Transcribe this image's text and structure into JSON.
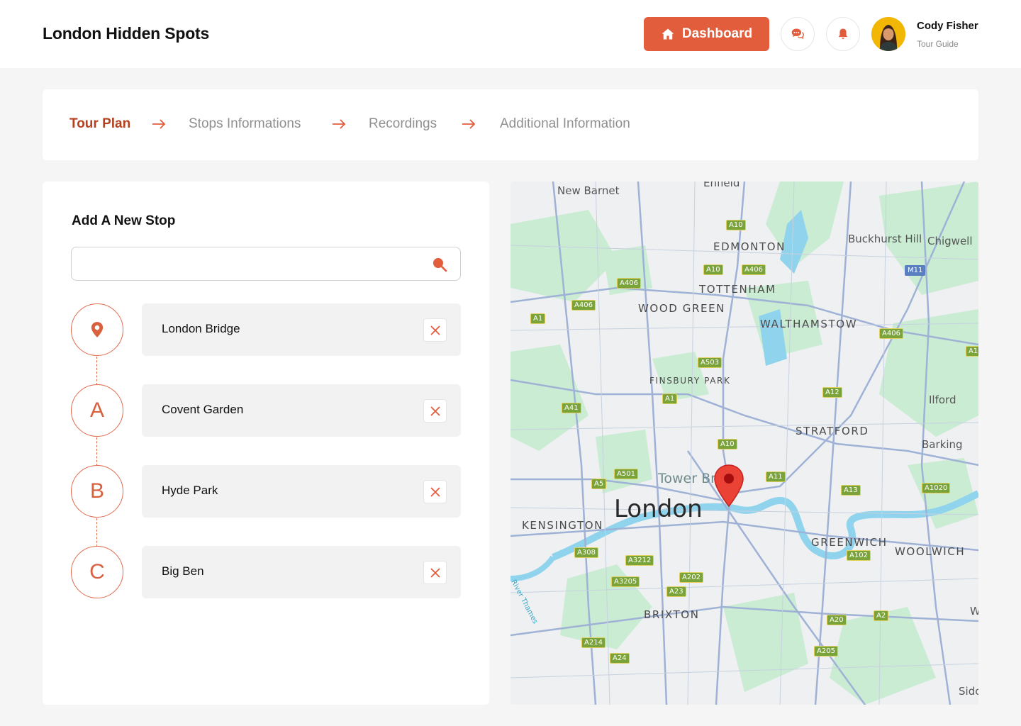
{
  "header": {
    "app_title": "London Hidden Spots",
    "dashboard_label": "Dashboard",
    "user": {
      "name": "Cody Fisher",
      "role": "Tour Guide"
    }
  },
  "stepper": {
    "steps": [
      {
        "label": "Tour Plan",
        "active": true
      },
      {
        "label": "Stops Informations",
        "active": false
      },
      {
        "label": "Recordings",
        "active": false
      },
      {
        "label": "Additional Information",
        "active": false
      }
    ]
  },
  "stop_panel": {
    "title": "Add A New Stop",
    "search_value": "",
    "stops": [
      {
        "marker": "",
        "marker_icon": "location-pin-icon",
        "label": "London Bridge"
      },
      {
        "marker": "A",
        "label": "Covent Garden"
      },
      {
        "marker": "B",
        "label": "Hyde Park"
      },
      {
        "marker": "C",
        "label": "Big Ben"
      }
    ]
  },
  "map": {
    "city_label": "London",
    "areas": [
      "EDMONTON",
      "TOTTENHAM",
      "WOOD GREEN",
      "WALTHAMSTOW",
      "FINSBURY PARK",
      "STRATFORD",
      "KENSINGTON",
      "GREENWICH",
      "WOOLWICH",
      "BRIXTON"
    ],
    "towns": [
      "New Barnet",
      "Enfield",
      "Buckhurst Hill",
      "Chigwell",
      "Ilford",
      "Barking",
      "Tower Br",
      "Sidc",
      "W"
    ],
    "roads": [
      "A10",
      "A10",
      "A406",
      "A406",
      "A406",
      "A406",
      "A1",
      "A503",
      "A1",
      "A12",
      "A41",
      "A10",
      "A501",
      "A5",
      "A11",
      "A13",
      "A1020",
      "A308",
      "A3212",
      "A202",
      "A3205",
      "A23",
      "A102",
      "A20",
      "A2",
      "A214",
      "A24",
      "A205",
      "M11",
      "A1"
    ],
    "river_label": "River Thames",
    "colors": {
      "park": "#c9ecd3",
      "water": "#8fd3ec",
      "road": "#9fb2d6",
      "pin": "#ea4335"
    }
  },
  "colors": {
    "accent": "#e25d3c",
    "accent_dark": "#b5401f"
  }
}
